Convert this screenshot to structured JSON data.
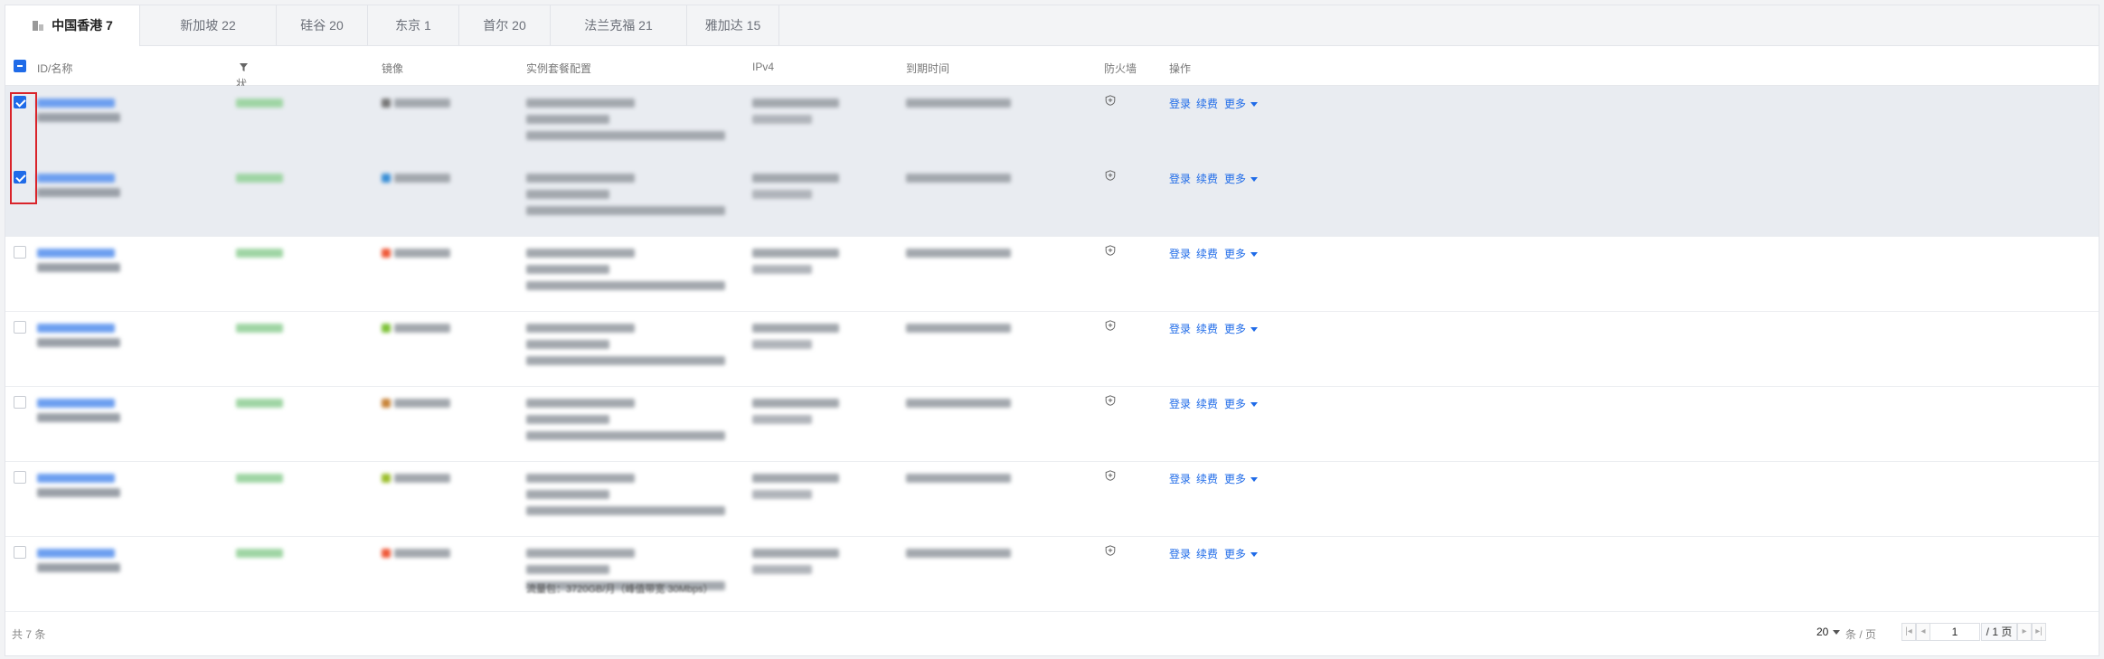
{
  "tabs": [
    {
      "label": "中国香港 7",
      "active": true
    },
    {
      "label": "新加坡 22",
      "active": false
    },
    {
      "label": "硅谷 20",
      "active": false
    },
    {
      "label": "东京 1",
      "active": false
    },
    {
      "label": "首尔 20",
      "active": false
    },
    {
      "label": "法兰克福 21",
      "active": false
    },
    {
      "label": "雅加达 15",
      "active": false
    }
  ],
  "table": {
    "headers": {
      "id": "ID/名称",
      "status": "状态",
      "image": "镜像",
      "config": "实例套餐配置",
      "ipv4": "IPv4",
      "expiry": "到期时间",
      "firewall": "防火墙",
      "ops": "操作"
    },
    "actions": {
      "login": "登录",
      "renew": "续费",
      "more": "更多"
    },
    "rows": [
      {
        "selected": true,
        "image_color": "#777777"
      },
      {
        "selected": true,
        "image_color": "#3a8fd6"
      },
      {
        "selected": false,
        "image_color": "#ef5a3a"
      },
      {
        "selected": false,
        "image_color": "#7ec23a"
      },
      {
        "selected": false,
        "image_color": "#c8843a"
      },
      {
        "selected": false,
        "image_color": "#9cbf2e"
      },
      {
        "selected": false,
        "image_color": "#ef5a3a"
      }
    ],
    "partial_text": "流量包：3720GB/月（峰值带宽 30Mbps）"
  },
  "footer": {
    "total": "共 7 条",
    "page_size": "20",
    "per_page": "条 / 页",
    "page": "1",
    "page_total": "/ 1 页"
  },
  "colors": {
    "accent": "#1f6be8",
    "highlight": "#d9242b",
    "selected_row": "#e9ecf1"
  }
}
